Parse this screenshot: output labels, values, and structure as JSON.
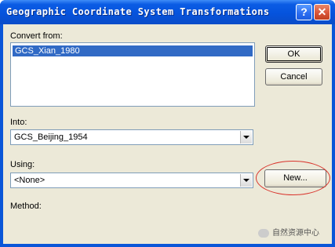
{
  "window": {
    "title": "Geographic Coordinate System Transformations",
    "help_label": "?",
    "close_label": "✕",
    "colors": {
      "titlebar": "#0553dd",
      "client": "#ece9d8",
      "selection": "#316ac5",
      "annotation": "#d9322a"
    }
  },
  "convert_from": {
    "label": "Convert from:",
    "items": [
      "GCS_Xian_1980"
    ]
  },
  "into": {
    "label": "Into:",
    "value": "GCS_Beijing_1954"
  },
  "using": {
    "label": "Using:",
    "value": "<None>"
  },
  "method": {
    "label": "Method:"
  },
  "buttons": {
    "ok": "OK",
    "cancel": "Cancel",
    "new": "New..."
  },
  "watermark": {
    "text": "自然资源中心",
    "icon": "wechat-icon"
  }
}
